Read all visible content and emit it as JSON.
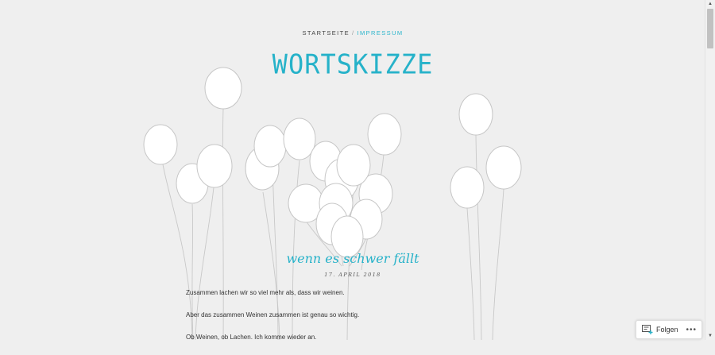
{
  "nav": {
    "home": "STARTSEITE",
    "separator": "/",
    "current": "IMPRESSUM"
  },
  "site": {
    "title": "WORTSKIZZE"
  },
  "post": {
    "title": "wenn es schwer fällt",
    "date": "17. APRIL 2018",
    "paragraphs": [
      "Zusammen lachen wir so viel mehr als, dass wir weinen.",
      "Aber das zusammen Weinen zusammen ist genau so wichtig.",
      "Ob Weinen, ob Lachen. Ich komme wieder an."
    ]
  },
  "follow": {
    "label": "Folgen",
    "icon": "follow-icon",
    "more": "•••"
  },
  "colors": {
    "accent": "#26b2c9",
    "background": "#efefef"
  }
}
